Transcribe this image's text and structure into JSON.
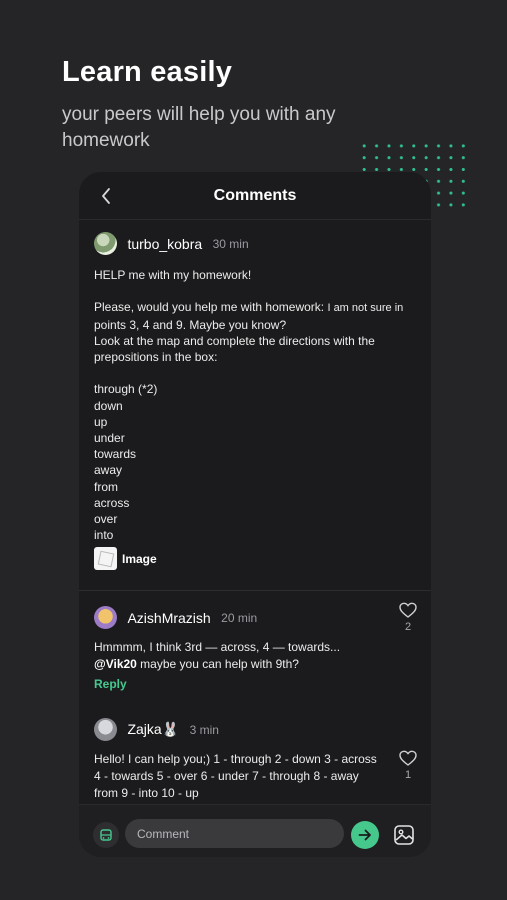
{
  "promo": {
    "headline": "Learn easily",
    "subline": "your peers will help you with any homework"
  },
  "header": {
    "title": "Comments",
    "back_icon": "chevron-left-icon"
  },
  "post": {
    "author": "turbo_kobra",
    "time": "30 min",
    "title_line": "HELP me with my homework!",
    "line_a": "Please, would you help me with homework: ",
    "line_a_small": "I am not sure in",
    "line_b": "points 3, 4 and 9. Maybe you know?\n Look at the map and complete the directions with the prepositions in the box:",
    "words": "through (*2)\ndown\nup\nunder\ntowards\naway\nfrom\nacross\nover\ninto",
    "attachment_label": "Image"
  },
  "comments": [
    {
      "author": "AzishMrazish",
      "time": "20 min",
      "text": "Hmmmm, I think 3rd — across, 4 — towards...",
      "mention": "@Vik20",
      "text_after": " maybe you can help with 9th?",
      "likes": "2",
      "reply_label": "Reply"
    },
    {
      "author": "Zajka🐰",
      "time": "3 min",
      "text": "Hello! I can help you;)              1 - through 2 - down 3 - across 4 - towards 5 - over 6 - under 7 - through 8 - away from 9 - into 10 - up",
      "likes": "1"
    }
  ],
  "composer": {
    "placeholder": "Comment"
  },
  "colors": {
    "accent": "#46c88d",
    "background": "#252527",
    "card": "#1b1b1d"
  }
}
